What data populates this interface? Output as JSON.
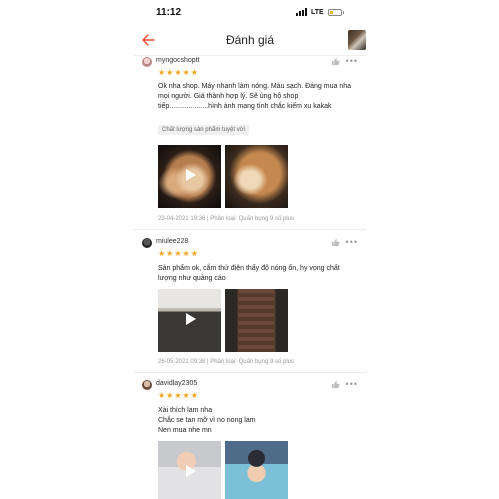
{
  "status_bar": {
    "time": "11:12",
    "network": "LTE"
  },
  "header": {
    "title": "Đánh giá"
  },
  "reviews": [
    {
      "username": "myngocshoptt",
      "rating": 5,
      "text": "Ok nha shop. Máy  nhanh  làm nóng. Màu sạch. Đáng mua nha mọi người. Giá thành hợp lý. Sẽ ủng hộ shop tiếp....................hình ảnh mang tính chắc kiếm xu kakak",
      "tag": "Chất lượng sản phẩm tuyệt vời",
      "meta": "23-04-2021 19:36 | Phân loại: Quấn bụng 9 số plus"
    },
    {
      "username": "miulee228",
      "rating": 5,
      "text": "Sản phẩm ok, cắm thử điện thấy độ nóng ổn, hy vọng chất lượng như quảng cáo",
      "meta": "26-05-2021 09:38 | Phân loại: Quấn bụng 9 số plus"
    },
    {
      "username": "davidlay2305",
      "rating": 5,
      "text": "Xài thích lam nha\nChắc se tan mỡ vì no nong lam\nNen mua nhe mn"
    }
  ],
  "icons": {
    "back": "back-arrow-icon",
    "like": "thumbs-up-icon",
    "more": "more-dots-icon",
    "play": "play-icon",
    "star": "star-icon"
  },
  "colors": {
    "accent": "#ee4d2d",
    "star": "#f3a31b"
  }
}
